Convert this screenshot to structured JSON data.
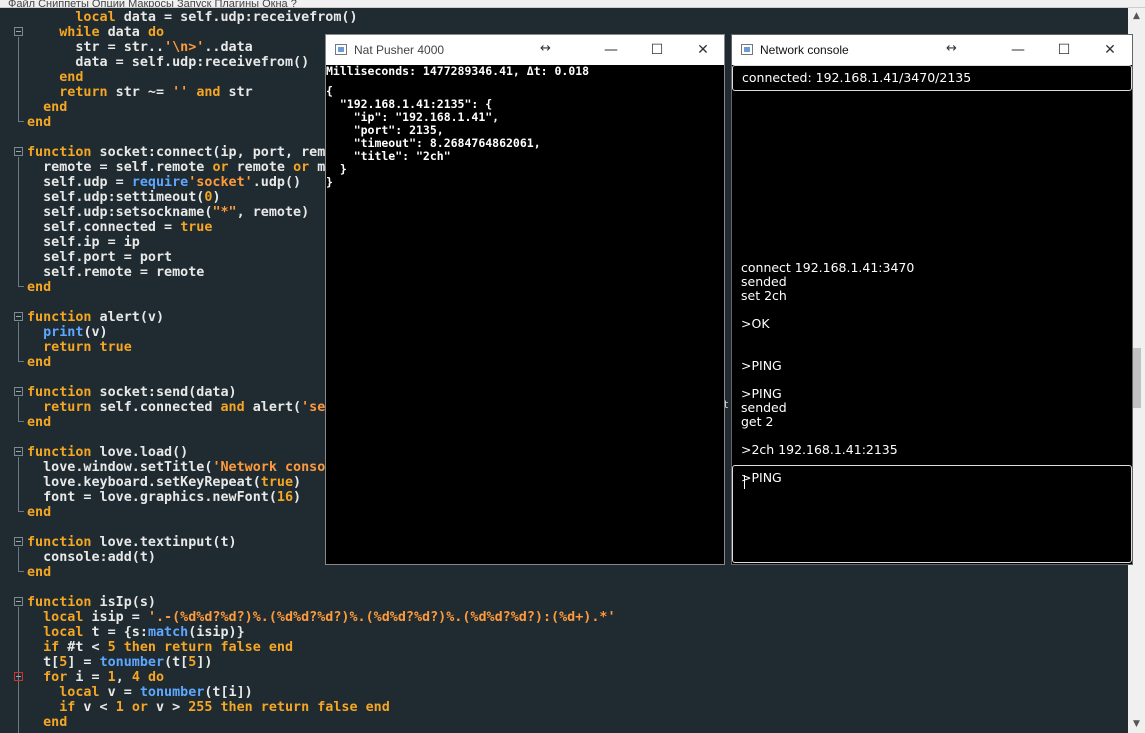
{
  "menubar": {
    "text": "Файл  Сниппеты  Опции  Макросы  Запуск  Плагины  Окна  ?"
  },
  "editor": {
    "lines": [
      [
        [
          "t",
          "      "
        ],
        [
          "k",
          "local"
        ],
        [
          "t",
          " data = self.udp:receivefrom()"
        ]
      ],
      [
        [
          "t",
          "    "
        ],
        [
          "k",
          "while"
        ],
        [
          "t",
          " data "
        ],
        [
          "k",
          "do"
        ]
      ],
      [
        [
          "t",
          "      str = str.."
        ],
        [
          "s",
          "'\\n>'"
        ],
        [
          "t",
          "..data"
        ]
      ],
      [
        [
          "t",
          "      data = self.udp:receivefrom()"
        ]
      ],
      [
        [
          "t",
          "    "
        ],
        [
          "k",
          "end"
        ]
      ],
      [
        [
          "t",
          "    "
        ],
        [
          "k",
          "return"
        ],
        [
          "t",
          " str ~= "
        ],
        [
          "s",
          "''"
        ],
        [
          "t",
          " "
        ],
        [
          "k",
          "and"
        ],
        [
          "t",
          " str"
        ]
      ],
      [
        [
          "t",
          "  "
        ],
        [
          "k",
          "end"
        ]
      ],
      [
        [
          "k",
          "end"
        ]
      ],
      [
        [
          "t",
          ""
        ]
      ],
      [
        [
          "k",
          "function"
        ],
        [
          "t",
          " socket:connect(ip, port, remo"
        ]
      ],
      [
        [
          "t",
          "  remote = self.remote "
        ],
        [
          "k",
          "or"
        ],
        [
          "t",
          " remote "
        ],
        [
          "k",
          "or"
        ],
        [
          "t",
          " m"
        ]
      ],
      [
        [
          "t",
          "  self.udp = "
        ],
        [
          "f",
          "require"
        ],
        [
          "s",
          "'socket'"
        ],
        [
          "t",
          ".udp()"
        ]
      ],
      [
        [
          "t",
          "  self.udp:settimeout("
        ],
        [
          "n",
          "0"
        ],
        [
          "t",
          ")"
        ]
      ],
      [
        [
          "t",
          "  self.udp:setsockname("
        ],
        [
          "s",
          "\"*\""
        ],
        [
          "t",
          ", remote)"
        ]
      ],
      [
        [
          "t",
          "  self.connected = "
        ],
        [
          "k",
          "true"
        ]
      ],
      [
        [
          "t",
          "  self.ip = ip"
        ]
      ],
      [
        [
          "t",
          "  self.port = port"
        ]
      ],
      [
        [
          "t",
          "  self.remote = remote"
        ]
      ],
      [
        [
          "k",
          "end"
        ]
      ],
      [
        [
          "t",
          ""
        ]
      ],
      [
        [
          "k",
          "function"
        ],
        [
          "t",
          " alert(v)"
        ]
      ],
      [
        [
          "t",
          "  "
        ],
        [
          "f",
          "print"
        ],
        [
          "t",
          "(v)"
        ]
      ],
      [
        [
          "t",
          "  "
        ],
        [
          "k",
          "return true"
        ]
      ],
      [
        [
          "k",
          "end"
        ]
      ],
      [
        [
          "t",
          ""
        ]
      ],
      [
        [
          "k",
          "function"
        ],
        [
          "t",
          " socket:send(data)"
        ]
      ],
      [
        [
          "t",
          "  "
        ],
        [
          "k",
          "return"
        ],
        [
          "t",
          " self.connected "
        ],
        [
          "k",
          "and"
        ],
        [
          "t",
          " alert("
        ],
        [
          "s",
          "'se"
        ]
      ],
      [
        [
          "k",
          "end"
        ]
      ],
      [
        [
          "t",
          ""
        ]
      ],
      [
        [
          "k",
          "function"
        ],
        [
          "t",
          " love.load()"
        ]
      ],
      [
        [
          "t",
          "  love.window.setTitle("
        ],
        [
          "s",
          "'Network conso"
        ]
      ],
      [
        [
          "t",
          "  love.keyboard.setKeyRepeat("
        ],
        [
          "k",
          "true"
        ],
        [
          "t",
          ")"
        ]
      ],
      [
        [
          "t",
          "  font = love.graphics.newFont("
        ],
        [
          "n",
          "16"
        ],
        [
          "t",
          ")"
        ]
      ],
      [
        [
          "k",
          "end"
        ]
      ],
      [
        [
          "t",
          ""
        ]
      ],
      [
        [
          "k",
          "function"
        ],
        [
          "t",
          " love.textinput(t)"
        ]
      ],
      [
        [
          "t",
          "  console:add(t)"
        ]
      ],
      [
        [
          "k",
          "end"
        ]
      ],
      [
        [
          "t",
          ""
        ]
      ],
      [
        [
          "k",
          "function"
        ],
        [
          "t",
          " isIp(s)"
        ]
      ],
      [
        [
          "t",
          "  "
        ],
        [
          "k",
          "local"
        ],
        [
          "t",
          " isip = "
        ],
        [
          "s",
          "'.-(%d%d?%d?)%.(%d%d?%d?)%.(%d%d?%d?)%.(%d%d?%d?):(%d+).*'"
        ]
      ],
      [
        [
          "t",
          "  "
        ],
        [
          "k",
          "local"
        ],
        [
          "t",
          " t = {s:"
        ],
        [
          "f",
          "match"
        ],
        [
          "t",
          "(isip)}"
        ]
      ],
      [
        [
          "t",
          "  "
        ],
        [
          "k",
          "if"
        ],
        [
          "t",
          " #t < "
        ],
        [
          "n",
          "5"
        ],
        [
          "t",
          " "
        ],
        [
          "k",
          "then return false end"
        ]
      ],
      [
        [
          "t",
          "  t["
        ],
        [
          "n",
          "5"
        ],
        [
          "t",
          "] = "
        ],
        [
          "f",
          "tonumber"
        ],
        [
          "t",
          "(t["
        ],
        [
          "n",
          "5"
        ],
        [
          "t",
          "])"
        ]
      ],
      [
        [
          "t",
          "  "
        ],
        [
          "k",
          "for"
        ],
        [
          "t",
          " i = "
        ],
        [
          "n",
          "1"
        ],
        [
          "t",
          ", "
        ],
        [
          "n",
          "4"
        ],
        [
          "t",
          " "
        ],
        [
          "k",
          "do"
        ]
      ],
      [
        [
          "t",
          "    "
        ],
        [
          "k",
          "local"
        ],
        [
          "t",
          " v = "
        ],
        [
          "f",
          "tonumber"
        ],
        [
          "t",
          "(t[i])"
        ]
      ],
      [
        [
          "t",
          "    "
        ],
        [
          "k",
          "if"
        ],
        [
          "t",
          " v < "
        ],
        [
          "n",
          "1"
        ],
        [
          "t",
          " "
        ],
        [
          "k",
          "or"
        ],
        [
          "t",
          " v > "
        ],
        [
          "n",
          "255"
        ],
        [
          "t",
          " "
        ],
        [
          "k",
          "then return false end"
        ]
      ],
      [
        [
          "t",
          "  "
        ],
        [
          "k",
          "end"
        ]
      ]
    ]
  },
  "scrollbar": {
    "up_icon": "▲",
    "down_icon": "▼"
  },
  "nat_pusher": {
    "title": "Nat Pusher 4000",
    "stats": "Milliseconds: 1477289346.41, Δt: 0.018",
    "json": "{\n  \"192.168.1.41:2135\": {\n    \"ip\": \"192.168.1.41\",\n    \"port\": 2135,\n    \"timeout\": 8.2684764862061,\n    \"title\": \"2ch\"\n  }\n}",
    "move_icon": "↔",
    "minimize": "—",
    "maximize": "☐",
    "close": "✕"
  },
  "network_console": {
    "title": "Network console",
    "status": "connected: 192.168.1.41/3470/2135",
    "log": "connect 192.168.1.41:3470\nsended\nset 2ch\n\n>OK\n\n\n>PING\n\n>PING\nsended\nget 2\n\n>2ch 192.168.1.41:2135\n\n>PING",
    "input_value": "",
    "move_icon": "↔",
    "minimize": "—",
    "maximize": "☐",
    "close": "✕"
  },
  "stray_char": "t"
}
